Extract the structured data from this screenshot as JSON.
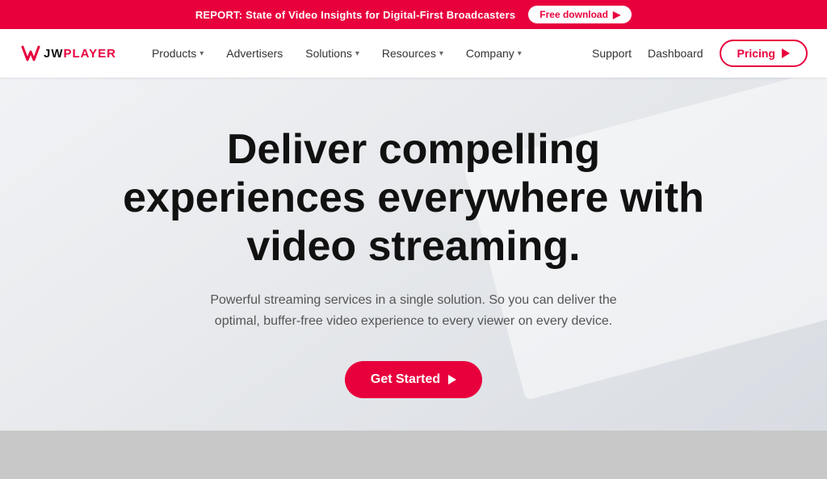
{
  "banner": {
    "text": "REPORT: State of Video Insights for Digital-First Broadcasters",
    "cta_label": "Free download",
    "cta_arrow": "→"
  },
  "navbar": {
    "logo_text": "JWPLAYER",
    "nav_items": [
      {
        "label": "Products",
        "has_dropdown": true
      },
      {
        "label": "Advertisers",
        "has_dropdown": false
      },
      {
        "label": "Solutions",
        "has_dropdown": true
      },
      {
        "label": "Resources",
        "has_dropdown": true
      },
      {
        "label": "Company",
        "has_dropdown": true
      }
    ],
    "right_links": [
      {
        "label": "Support"
      },
      {
        "label": "Dashboard"
      }
    ],
    "pricing_label": "Pricing"
  },
  "hero": {
    "title": "Deliver compelling experiences everywhere with video streaming.",
    "subtitle": "Powerful streaming services in a single solution. So you can deliver the optimal, buffer-free video experience to every viewer on every device.",
    "cta_label": "Get Started"
  }
}
